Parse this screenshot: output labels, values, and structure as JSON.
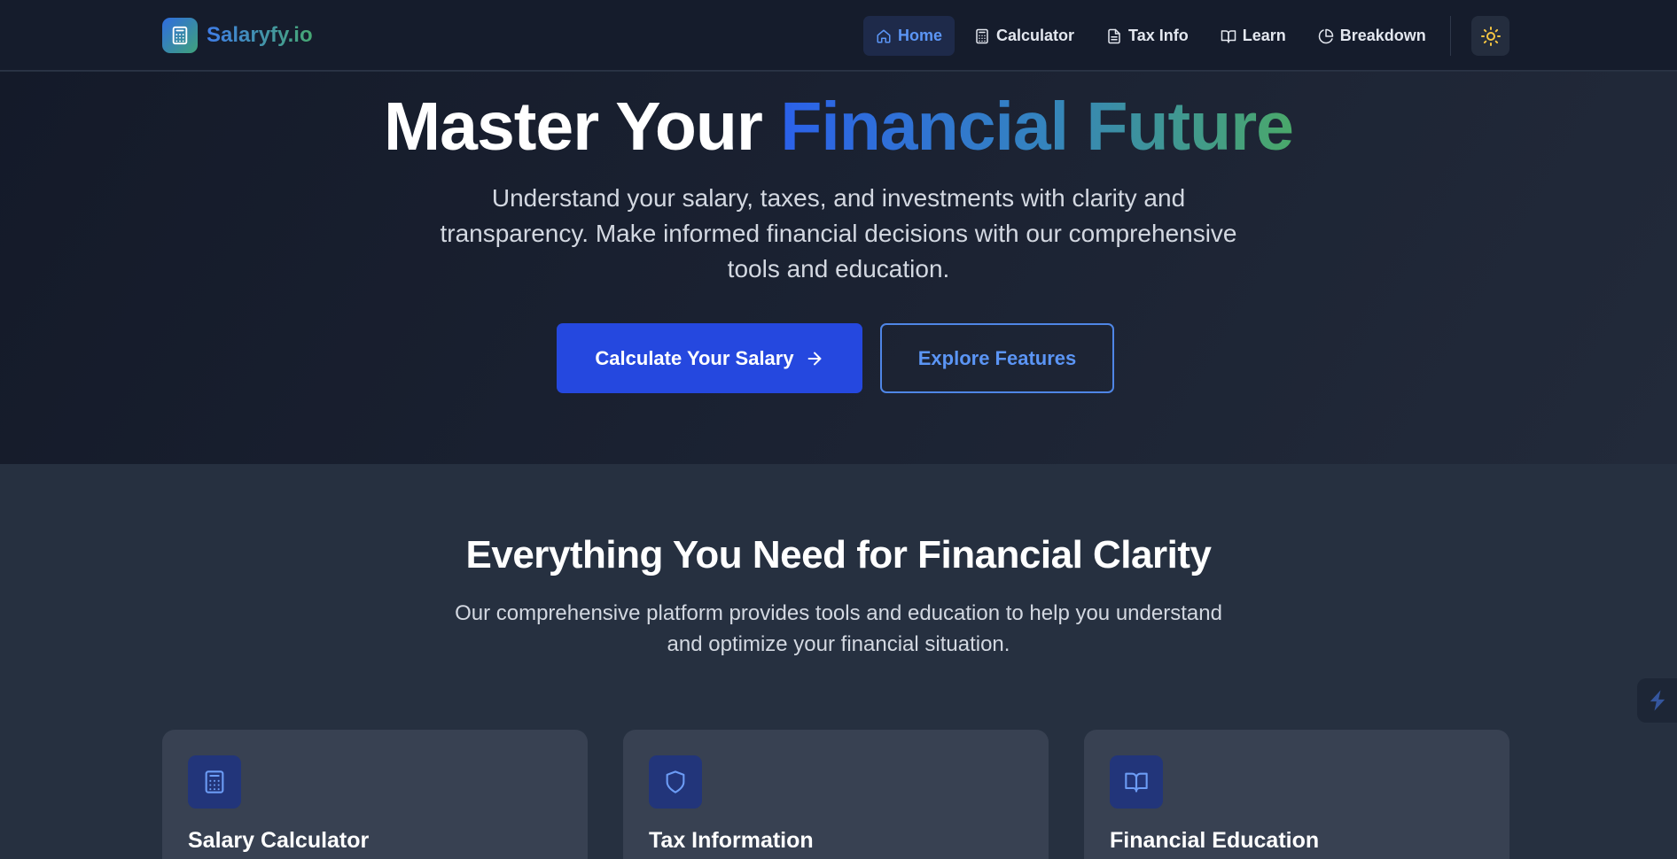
{
  "brand": {
    "name": "Salaryfy.io",
    "logo_icon": "calculator-icon"
  },
  "nav": {
    "links": [
      {
        "label": "Home",
        "icon": "home-icon",
        "active": true
      },
      {
        "label": "Calculator",
        "icon": "calculator-icon",
        "active": false
      },
      {
        "label": "Tax Info",
        "icon": "document-icon",
        "active": false
      },
      {
        "label": "Learn",
        "icon": "book-icon",
        "active": false
      },
      {
        "label": "Breakdown",
        "icon": "pie-chart-icon",
        "active": false
      }
    ],
    "theme_toggle_icon": "sun-icon"
  },
  "hero": {
    "title_plain": "Master Your",
    "title_highlight": "Financial Future",
    "subtitle": "Understand your salary, taxes, and investments with clarity and transparency. Make informed financial decisions with our comprehensive tools and education.",
    "primary_cta": "Calculate Your Salary",
    "secondary_cta": "Explore Features"
  },
  "features": {
    "title": "Everything You Need for Financial Clarity",
    "subtitle": "Our comprehensive platform provides tools and education to help you understand and optimize your financial situation.",
    "cards": [
      {
        "title": "Salary Calculator",
        "icon": "calculator-icon"
      },
      {
        "title": "Tax Information",
        "icon": "shield-icon"
      },
      {
        "title": "Financial Education",
        "icon": "book-icon"
      }
    ]
  },
  "colors": {
    "accent_blue": "#2548df",
    "link_active": "#5b95f5",
    "gradient_start": "#2b61ea",
    "gradient_end": "#4aa86a",
    "sun_yellow": "#f5c542"
  }
}
